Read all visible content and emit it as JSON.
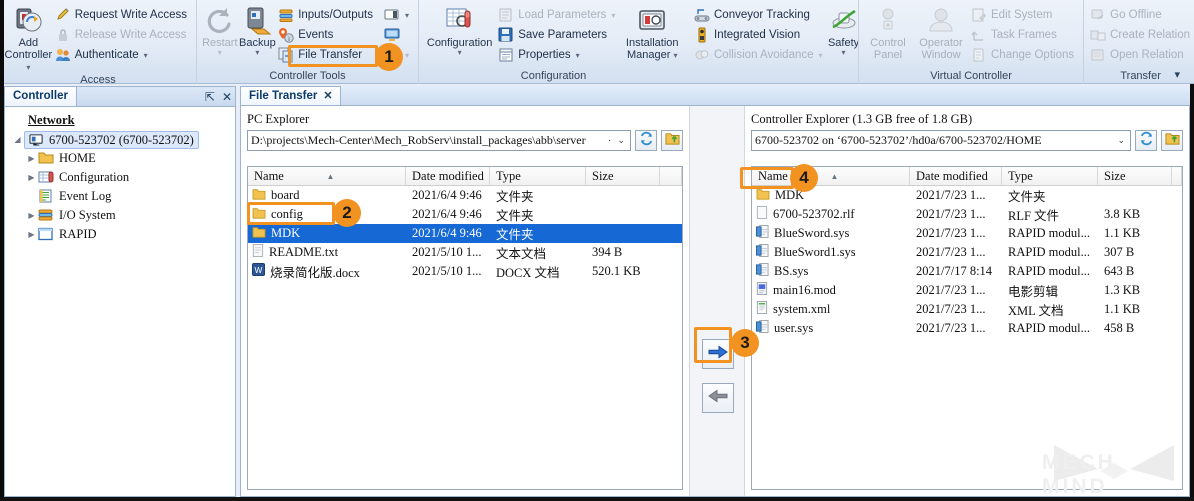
{
  "ribbon": {
    "groups": [
      {
        "title": "Access",
        "big": {
          "label_line1": "Add",
          "label_line2": "Controller",
          "icon": "add-controller-icon",
          "has_caret": true,
          "disabled": false
        },
        "small": [
          {
            "label": "Request Write Access",
            "icon": "pencil-icon",
            "disabled": false,
            "caret": false
          },
          {
            "label": "Release Write Access",
            "icon": "lock-icon",
            "disabled": true,
            "caret": false
          },
          {
            "label": "Authenticate",
            "icon": "users-icon",
            "disabled": false,
            "caret": true
          }
        ]
      },
      {
        "title": "Controller Tools",
        "bigs": [
          {
            "label_line1": "Restart",
            "label_line2": "",
            "icon": "restart-icon",
            "has_caret": true,
            "disabled": true
          },
          {
            "label_line1": "Backup",
            "label_line2": "",
            "icon": "backup-icon",
            "has_caret": true,
            "disabled": false
          }
        ],
        "small": [
          {
            "label": "Inputs/Outputs",
            "icon": "inputs-outputs-icon",
            "disabled": false,
            "caret": false
          },
          {
            "label": "Events",
            "icon": "events-icon",
            "disabled": false,
            "caret": false
          },
          {
            "label": "File Transfer",
            "icon": "file-transfer-icon",
            "disabled": false,
            "caret": false,
            "highlighted": true
          }
        ],
        "small2": [
          {
            "label": "",
            "icon": "monitor-small-icon",
            "disabled": false,
            "caret": true
          },
          {
            "label": "",
            "icon": "monitor-icon",
            "disabled": false,
            "caret": false
          },
          {
            "label": "",
            "icon": "blank-icon",
            "disabled": true,
            "caret": true
          }
        ]
      },
      {
        "title": "Configuration",
        "big": {
          "label_line1": "Configuration",
          "label_line2": "",
          "icon": "configuration-icon",
          "has_caret": true,
          "disabled": false
        },
        "small": [
          {
            "label": "Load Parameters",
            "icon": "load-parameters-icon",
            "disabled": true,
            "caret": true
          },
          {
            "label": "Save Parameters",
            "icon": "save-parameters-icon",
            "disabled": false,
            "caret": false
          },
          {
            "label": "Properties",
            "icon": "properties-icon",
            "disabled": false,
            "caret": true
          }
        ],
        "big2": {
          "label_line1": "Installation",
          "label_line2": "Manager",
          "icon": "installation-manager-icon",
          "has_caret": true,
          "disabled": false
        },
        "small2": [
          {
            "label": "Conveyor Tracking",
            "icon": "conveyor-tracking-icon",
            "disabled": false,
            "caret": false
          },
          {
            "label": "Integrated Vision",
            "icon": "integrated-vision-icon",
            "disabled": false,
            "caret": false
          },
          {
            "label": "Collision Avoidance",
            "icon": "collision-avoidance-icon",
            "disabled": true,
            "caret": true
          }
        ],
        "big3": {
          "label_line1": "Safety",
          "label_line2": "",
          "icon": "safety-icon",
          "has_caret": true,
          "disabled": false
        }
      },
      {
        "title": "Virtual Controller",
        "bigs": [
          {
            "label_line1": "Control",
            "label_line2": "Panel",
            "icon": "control-panel-icon",
            "has_caret": false,
            "disabled": true
          },
          {
            "label_line1": "Operator",
            "label_line2": "Window",
            "icon": "operator-window-icon",
            "has_caret": false,
            "disabled": true
          }
        ],
        "small": [
          {
            "label": "Edit System",
            "icon": "edit-system-icon",
            "disabled": true,
            "caret": false
          },
          {
            "label": "Task Frames",
            "icon": "task-frames-icon",
            "disabled": true,
            "caret": false
          },
          {
            "label": "Change Options",
            "icon": "change-options-icon",
            "disabled": true,
            "caret": false
          }
        ]
      },
      {
        "title": "Transfer",
        "small": [
          {
            "label": "Go Offline",
            "icon": "go-offline-icon",
            "disabled": true,
            "caret": false
          },
          {
            "label": "Create Relation",
            "icon": "create-relation-icon",
            "disabled": true,
            "caret": false
          },
          {
            "label": "Open Relation",
            "icon": "open-relation-icon",
            "disabled": true,
            "caret": false
          }
        ]
      }
    ]
  },
  "left_panel": {
    "tab_label": "Controller",
    "pin_icon": "pin-icon",
    "close_icon": "close-icon",
    "tree": [
      {
        "label": "Network",
        "icon": "network-icon",
        "indent": 0,
        "expander": "",
        "selected": false,
        "underline": true
      },
      {
        "label": "6700-523702  (6700-523702)",
        "icon": "controller-icon",
        "indent": 0,
        "expander": "down",
        "selected": true,
        "underline": false
      },
      {
        "label": "HOME",
        "icon": "folder-icon",
        "indent": 1,
        "expander": "right",
        "selected": false,
        "underline": false
      },
      {
        "label": "Configuration",
        "icon": "configuration-tree-icon",
        "indent": 1,
        "expander": "right",
        "selected": false,
        "underline": false
      },
      {
        "label": "Event Log",
        "icon": "event-log-icon",
        "indent": 1,
        "expander": "",
        "selected": false,
        "underline": false
      },
      {
        "label": "I/O System",
        "icon": "io-system-icon",
        "indent": 1,
        "expander": "right",
        "selected": false,
        "underline": false
      },
      {
        "label": "RAPID",
        "icon": "rapid-icon",
        "indent": 1,
        "expander": "right",
        "selected": false,
        "underline": false
      }
    ]
  },
  "doc_tab": {
    "label": "File Transfer",
    "close_icon": "close-icon"
  },
  "pc_explorer": {
    "title": "PC Explorer",
    "path": "D:\\projects\\Mech-Center\\Mech_RobServ\\install_packages\\abb\\server",
    "path_ellipsis": "·",
    "dropdown_icon": "chevron-down-icon",
    "refresh_icon": "refresh-icon",
    "up_folder_icon": "up-folder-icon",
    "columns": [
      "Name",
      "Date modified",
      "Type",
      "Size"
    ],
    "sort_indicator": "^",
    "rows": [
      {
        "name": "board",
        "date": "2021/6/4 9:46",
        "type": "文件夹",
        "size": "",
        "icon": "folder-icon",
        "selected": false
      },
      {
        "name": "config",
        "date": "2021/6/4 9:46",
        "type": "文件夹",
        "size": "",
        "icon": "folder-icon",
        "selected": false
      },
      {
        "name": "MDK",
        "date": "2021/6/4 9:46",
        "type": "文件夹",
        "size": "",
        "icon": "folder-icon",
        "selected": true
      },
      {
        "name": "README.txt",
        "date": "2021/5/10 1...",
        "type": "文本文档",
        "size": "394 B",
        "icon": "text-file-icon",
        "selected": false
      },
      {
        "name": "烧录简化版.docx",
        "date": "2021/5/10 1...",
        "type": "DOCX 文档",
        "size": "520.1 KB",
        "icon": "word-file-icon",
        "selected": false
      }
    ]
  },
  "controller_explorer": {
    "title": "Controller Explorer (1.3 GB free of 1.8 GB)",
    "path": "6700-523702 on ‘6700-523702’/hd0a/6700-523702/HOME",
    "dropdown_icon": "chevron-down-icon",
    "refresh_icon": "refresh-icon",
    "up_folder_icon": "up-folder-icon",
    "columns": [
      "Name",
      "Date modified",
      "Type",
      "Size"
    ],
    "sort_indicator": "^",
    "rows": [
      {
        "name": "MDK",
        "date": "2021/7/23 1...",
        "type": "文件夹",
        "size": "",
        "icon": "folder-icon",
        "selected": false
      },
      {
        "name": "6700-523702.rlf",
        "date": "2021/7/23 1...",
        "type": "RLF 文件",
        "size": "3.8 KB",
        "icon": "generic-file-icon",
        "selected": false
      },
      {
        "name": "BlueSword.sys",
        "date": "2021/7/23 1...",
        "type": "RAPID modul...",
        "size": "1.1 KB",
        "icon": "rapid-file-icon",
        "selected": false
      },
      {
        "name": "BlueSword1.sys",
        "date": "2021/7/23 1...",
        "type": "RAPID modul...",
        "size": "307 B",
        "icon": "rapid-file-icon",
        "selected": false
      },
      {
        "name": "BS.sys",
        "date": "2021/7/17 8:14",
        "type": "RAPID modul...",
        "size": "643 B",
        "icon": "rapid-file-icon",
        "selected": false
      },
      {
        "name": "main16.mod",
        "date": "2021/7/23 1...",
        "type": "电影剪辑",
        "size": "1.3 KB",
        "icon": "mod-file-icon",
        "selected": false
      },
      {
        "name": "system.xml",
        "date": "2021/7/23 1...",
        "type": "XML 文档",
        "size": "1.1 KB",
        "icon": "xml-file-icon",
        "selected": false
      },
      {
        "name": "user.sys",
        "date": "2021/7/23 1...",
        "type": "RAPID modul...",
        "size": "458 B",
        "icon": "rapid-file-icon",
        "selected": false
      }
    ]
  },
  "transfer_buttons": {
    "to_controller": {
      "icon": "arrow-right-icon",
      "enabled": true
    },
    "to_pc": {
      "icon": "arrow-left-icon",
      "enabled": false
    }
  },
  "callouts": [
    {
      "number": "1"
    },
    {
      "number": "2"
    },
    {
      "number": "3"
    },
    {
      "number": "4"
    }
  ],
  "watermark": {
    "text": "MECH MIND",
    "logo_icon": "mech-mind-logo-icon"
  },
  "colors": {
    "accent_orange": "#f29220",
    "selection_blue": "#1669d4",
    "ribbon_bg": "#e3ebf6",
    "panel_border": "#9db4cf"
  }
}
